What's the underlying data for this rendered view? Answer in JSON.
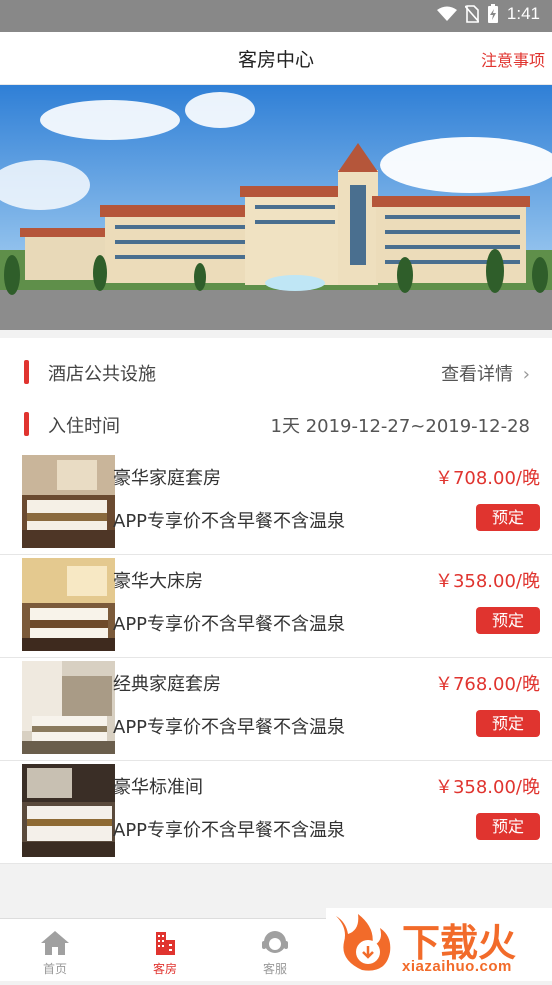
{
  "status_bar": {
    "time": "1:41"
  },
  "header": {
    "title": "客房中心",
    "action": "注意事项"
  },
  "facilities": {
    "label": "酒店公共设施",
    "link": "查看详情",
    "chevron": "›"
  },
  "checkin": {
    "label": "入住时间",
    "value": "1天 2019-12-27~2019-12-28"
  },
  "rooms": [
    {
      "name": "豪华家庭套房",
      "price": "￥708.00/晚",
      "desc": "APP专享价不含早餐不含温泉",
      "button": "预定"
    },
    {
      "name": "豪华大床房",
      "price": "￥358.00/晚",
      "desc": "APP专享价不含早餐不含温泉",
      "button": "预定"
    },
    {
      "name": "经典家庭套房",
      "price": "￥768.00/晚",
      "desc": "APP专享价不含早餐不含温泉",
      "button": "预定"
    },
    {
      "name": "豪华标准间",
      "price": "￥358.00/晚",
      "desc": "APP专享价不含早餐不含温泉",
      "button": "预定"
    }
  ],
  "tabs": [
    {
      "label": "首页",
      "icon": "home-icon"
    },
    {
      "label": "客房",
      "icon": "building-icon",
      "active": true
    },
    {
      "label": "客服",
      "icon": "headset-icon"
    }
  ],
  "watermark": {
    "brand": "下载火",
    "url": "xiazaihuo.com"
  },
  "colors": {
    "accent": "#e0342f",
    "status_bar": "#888888"
  }
}
